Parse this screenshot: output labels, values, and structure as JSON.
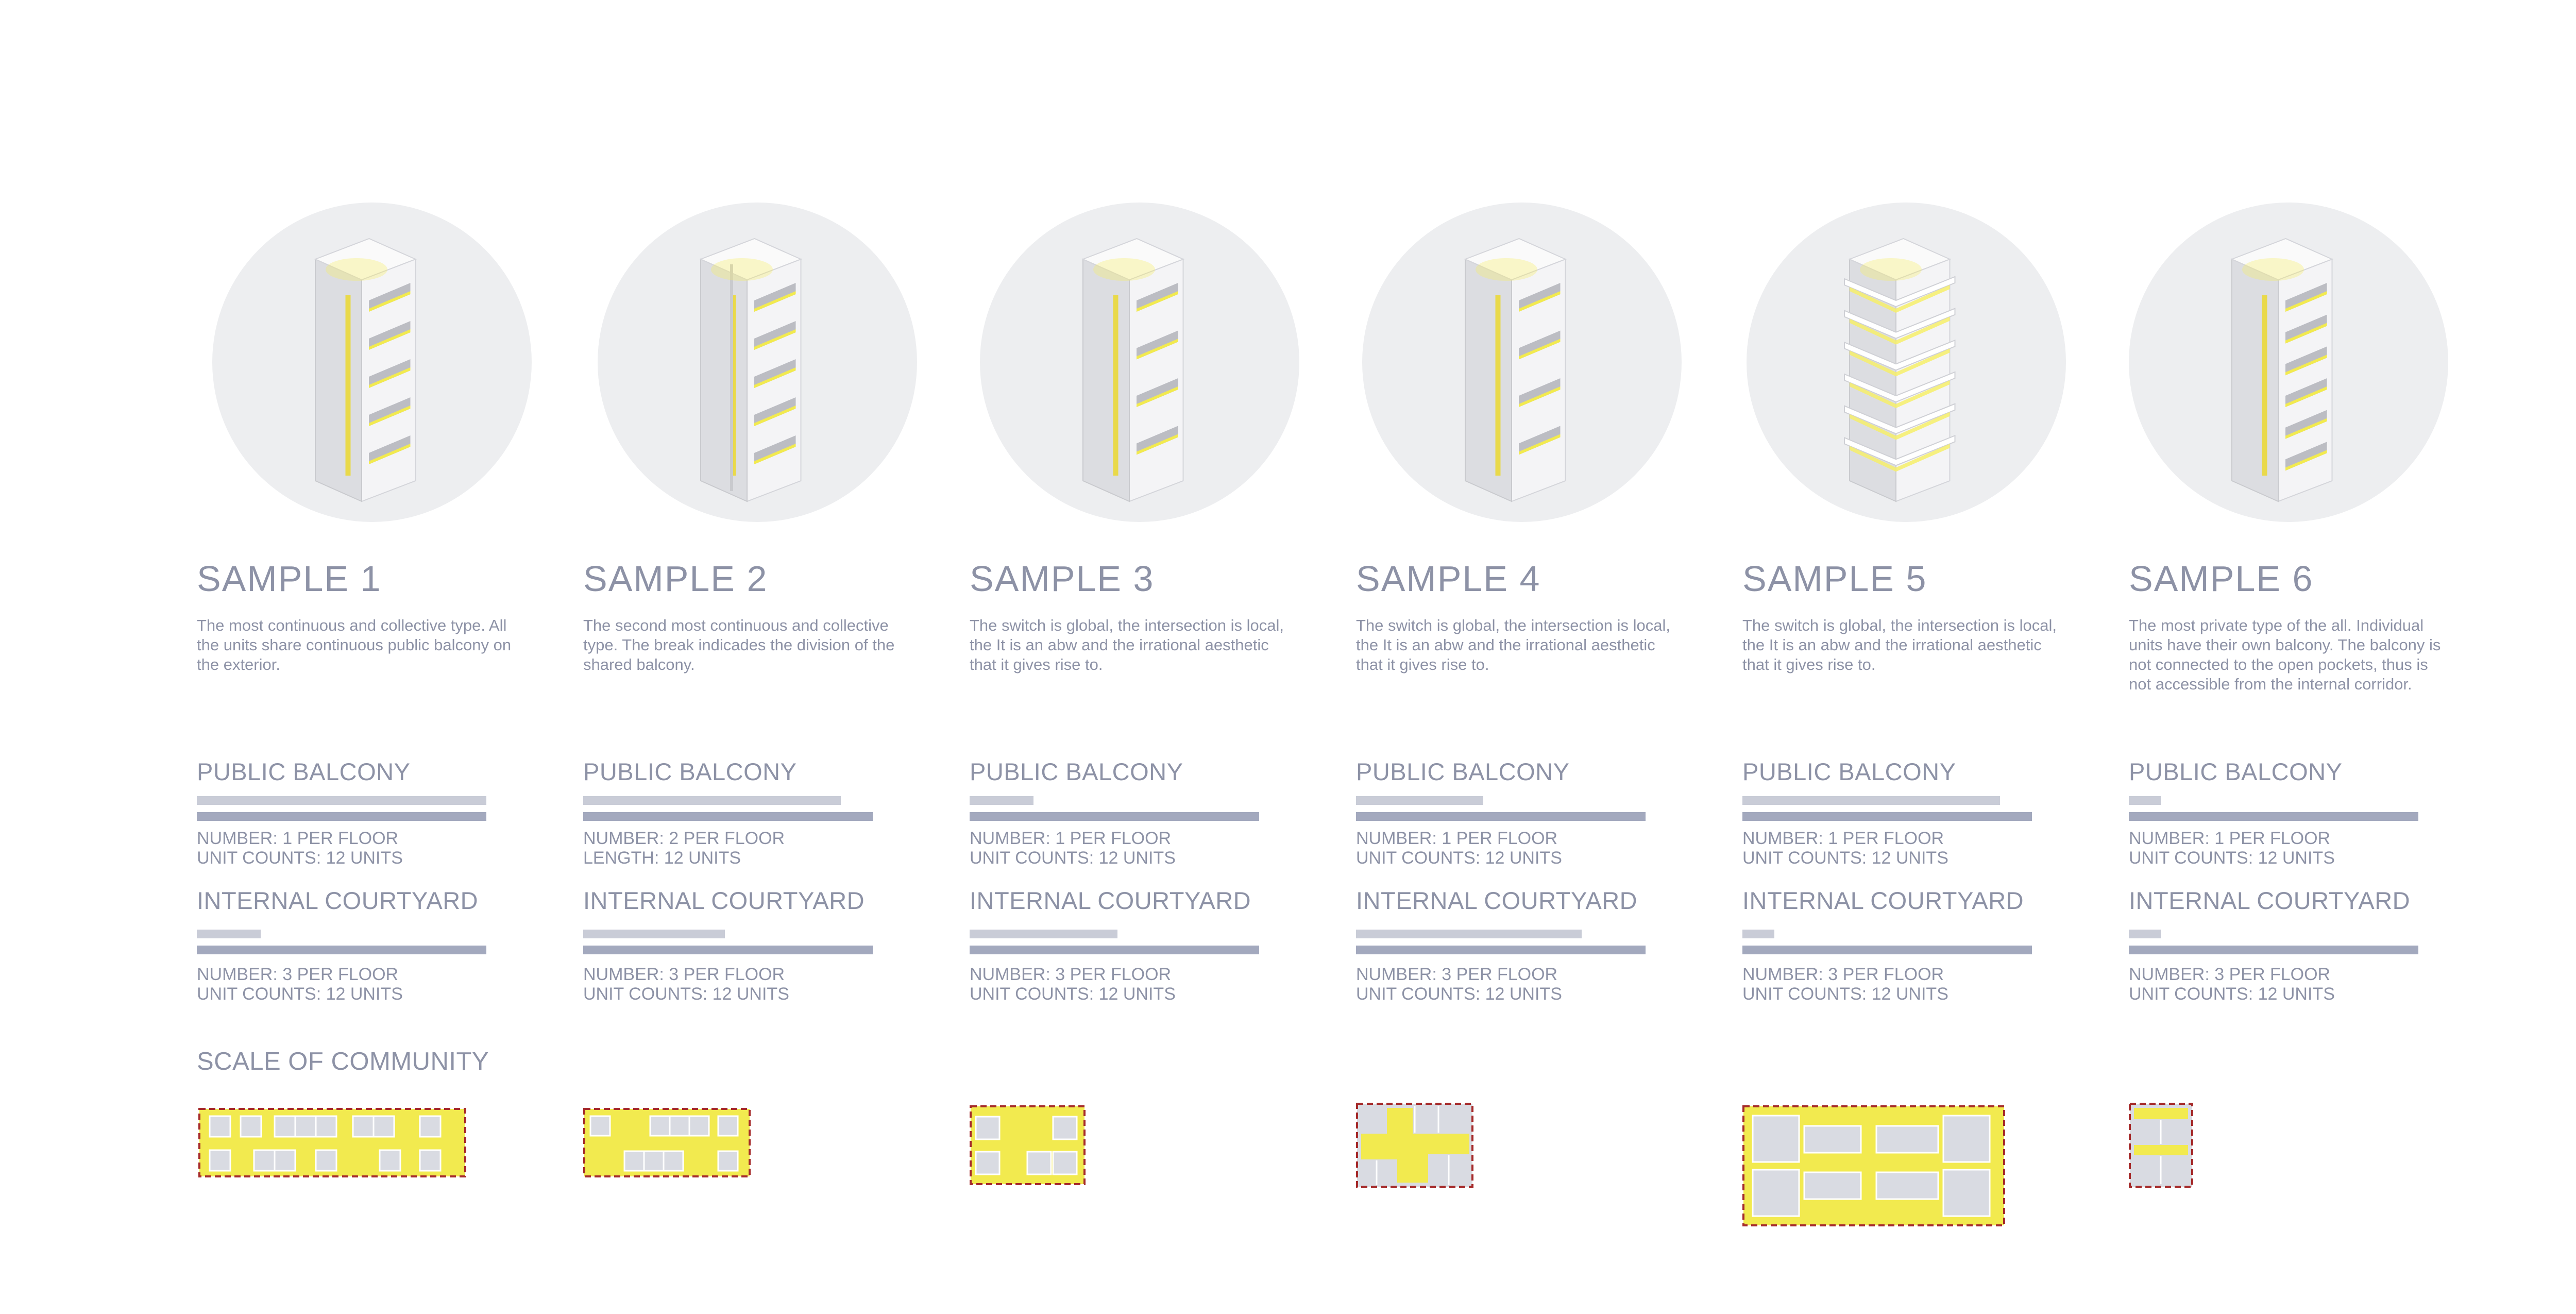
{
  "scale_of_community": "SCALE OF COMMUNITY",
  "samples": [
    {
      "title": "SAMPLE 1",
      "description": "The most continuous and collective type. All the units share continuous public balcony on the exterior.",
      "public_balcony": {
        "label": "PUBLIC BALCONY",
        "level": 1.0,
        "line1": "NUMBER: 1 PER FLOOR",
        "line2": "UNIT COUNTS: 12 UNITS"
      },
      "internal_courtyard": {
        "label": "INTERNAL COURTYARD",
        "level": 0.22,
        "line1": "NUMBER: 3 PER FLOOR",
        "line2": "UNIT COUNTS: 12 UNITS"
      }
    },
    {
      "title": "SAMPLE 2",
      "description": "The second most continuous and collective type. The break indicades the division of the shared balcony.",
      "public_balcony": {
        "label": "PUBLIC BALCONY",
        "level": 0.89,
        "line1": "NUMBER: 2 PER FLOOR",
        "line2": "LENGTH: 12 UNITS"
      },
      "internal_courtyard": {
        "label": "INTERNAL COURTYARD",
        "level": 0.49,
        "line1": "NUMBER: 3 PER FLOOR",
        "line2": "UNIT COUNTS: 12 UNITS"
      }
    },
    {
      "title": "SAMPLE 3",
      "description": "The switch is global, the intersection is local, the It is an abw and the irrational aesthetic that it gives rise to.",
      "public_balcony": {
        "label": "PUBLIC BALCONY",
        "level": 0.22,
        "line1": "NUMBER: 1 PER FLOOR",
        "line2": "UNIT COUNTS: 12 UNITS"
      },
      "internal_courtyard": {
        "label": "INTERNAL COURTYARD",
        "level": 0.51,
        "line1": "NUMBER: 3 PER FLOOR",
        "line2": "UNIT COUNTS: 12 UNITS"
      }
    },
    {
      "title": "SAMPLE 4",
      "description": "The switch is global, the intersection is local, the It is an abw and the irrational aesthetic that it gives rise to.",
      "public_balcony": {
        "label": "PUBLIC BALCONY",
        "level": 0.44,
        "line1": "NUMBER: 1 PER FLOOR",
        "line2": "UNIT COUNTS: 12 UNITS"
      },
      "internal_courtyard": {
        "label": "INTERNAL COURTYARD",
        "level": 0.78,
        "line1": "NUMBER: 3 PER FLOOR",
        "line2": "UNIT COUNTS: 12 UNITS"
      }
    },
    {
      "title": "SAMPLE 5",
      "description": "The switch is global, the intersection is local, the It is an abw and the irrational aesthetic that it gives rise to.",
      "public_balcony": {
        "label": "PUBLIC BALCONY",
        "level": 0.89,
        "line1": "NUMBER: 1 PER FLOOR",
        "line2": "UNIT COUNTS: 12 UNITS"
      },
      "internal_courtyard": {
        "label": "INTERNAL COURTYARD",
        "level": 0.11,
        "line1": "NUMBER: 3 PER FLOOR",
        "line2": "UNIT COUNTS: 12 UNITS"
      }
    },
    {
      "title": "SAMPLE 6",
      "description": "The most private type of the all. Individual units have their own balcony. The balcony is not connected to the open pockets, thus is not accessible from the internal corridor.",
      "public_balcony": {
        "label": "PUBLIC BALCONY",
        "level": 0.11,
        "line1": "NUMBER: 1 PER FLOOR",
        "line2": "UNIT COUNTS: 12 UNITS"
      },
      "internal_courtyard": {
        "label": "INTERNAL COURTYARD",
        "level": 0.11,
        "line1": "NUMBER: 3 PER FLOOR",
        "line2": "UNIT COUNTS: 12 UNITS"
      }
    }
  ],
  "colors": {
    "text": "#8d92a6",
    "circle_bg": "#edeef0",
    "bar_light": "#c9ccd7",
    "bar_dark": "#a3a9be",
    "courtyard_yellow": "#f2ea4f",
    "unit_grey": "#d9dbe2",
    "dashed_border": "#a52a2a"
  }
}
